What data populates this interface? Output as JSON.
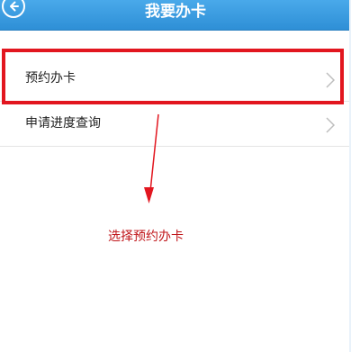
{
  "header": {
    "title": "我要办卡",
    "back_icon": "back-arrow-icon"
  },
  "list": {
    "items": [
      {
        "label": "预约办卡",
        "icon": "chevron-right-icon"
      },
      {
        "label": "申请进度查询",
        "icon": "chevron-right-icon"
      }
    ]
  },
  "annotation": {
    "text": "选择预约办卡",
    "color": "#e2161f"
  },
  "colors": {
    "header_bg": "#3a9ee2",
    "highlight": "#e2161f"
  }
}
